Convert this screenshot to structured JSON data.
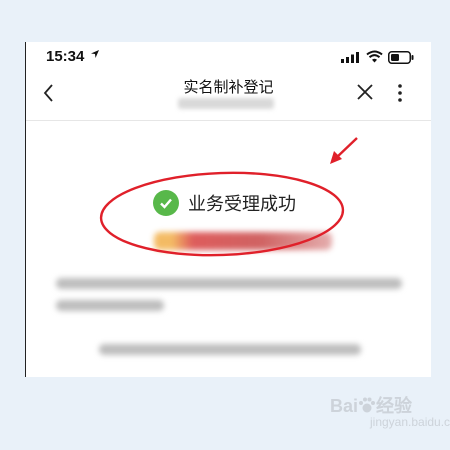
{
  "status_bar": {
    "time": "15:34"
  },
  "nav": {
    "title": "实名制补登记"
  },
  "result": {
    "message": "业务受理成功",
    "icon": "check-circle-icon",
    "icon_color": "#58b84a"
  },
  "annotation": {
    "color": "#e0202a"
  },
  "watermark": {
    "brand": "Bai",
    "suffix": "经验",
    "site": "jingyan.baidu.com"
  }
}
